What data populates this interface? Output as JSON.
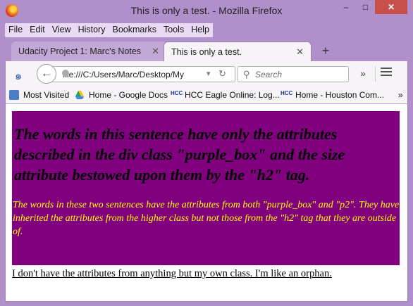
{
  "window": {
    "title": "This is only a test. - Mozilla Firefox",
    "controls": {
      "minimize": "–",
      "maximize": "□",
      "close": "✕"
    }
  },
  "menu": [
    "File",
    "Edit",
    "View",
    "History",
    "Bookmarks",
    "Tools",
    "Help"
  ],
  "tabs": [
    {
      "label": "Udacity Project 1: Marc's Notes",
      "active": false
    },
    {
      "label": "This is only a test.",
      "active": true
    }
  ],
  "navbar": {
    "url": "file:///C:/Users/Marc/Desktop/My",
    "search_placeholder": "Search"
  },
  "bookmarks": [
    {
      "label": "Most Visited",
      "icon": "bookmarks-icon"
    },
    {
      "label": "Home - Google Docs",
      "icon": "google-drive-icon"
    },
    {
      "label": "HCC Eagle Online: Log...",
      "icon": "hcc-icon"
    },
    {
      "label": "Home - Houston Com...",
      "icon": "hcc-icon"
    }
  ],
  "page": {
    "h2": "The words in this sentence have only the attributes described in the div class \"purple_box\" and the size attribute bestowed upon them by the \"h2\" tag.",
    "p2": "The words in these two sentences have the attributes from both \"purple_box\" and \"p2\". They have inherited the attributes from the higher class but not those from the \"h2\" tag that they are outside of.",
    "orphan": "I don't have the attributes from anything but my own class. I'm like an orphan."
  },
  "colors": {
    "purple_box": "#800080",
    "p2_text": "#ffff00",
    "chrome": "#b18fcb"
  }
}
